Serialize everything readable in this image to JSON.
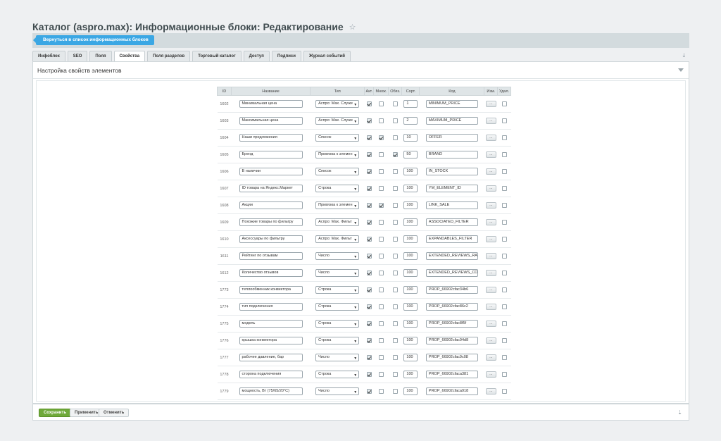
{
  "header": {
    "title": "Каталог (aspro.max): Информационные блоки: Редактирование",
    "star_icon": "star-icon"
  },
  "back_button": "Вернуться в список информационных блоков",
  "tabs": [
    {
      "label": "Инфоблок"
    },
    {
      "label": "SEO"
    },
    {
      "label": "Поля"
    },
    {
      "label": "Свойства",
      "active": true
    },
    {
      "label": "Поля разделов"
    },
    {
      "label": "Торговый каталог"
    },
    {
      "label": "Доступ"
    },
    {
      "label": "Подписи"
    },
    {
      "label": "Журнал событий"
    }
  ],
  "section": {
    "title": "Настройка свойств элементов"
  },
  "table": {
    "headers": [
      "ID",
      "Название",
      "Тип",
      "Акт.",
      "Множ.",
      "Обяз.",
      "Сорт.",
      "Код",
      "Изм.",
      "Удал."
    ],
    "edit_label": "...",
    "rows": [
      {
        "id": "1602",
        "name": "Минимальная цена",
        "type": "Аспро: Мах. Служе",
        "active": true,
        "multiple": false,
        "required": false,
        "sort": "1",
        "code": "MINIMUM_PRICE"
      },
      {
        "id": "1603",
        "name": "Максимальная цена",
        "type": "Аспро: Мах. Служе",
        "active": true,
        "multiple": false,
        "required": false,
        "sort": "2",
        "code": "MAXIMUM_PRICE"
      },
      {
        "id": "1604",
        "name": "Наши предложения",
        "type": "Список",
        "active": true,
        "multiple": true,
        "required": false,
        "sort": "10",
        "code": "OFFER"
      },
      {
        "id": "1605",
        "name": "Бренд",
        "type": "Привязка к элемен",
        "active": true,
        "multiple": false,
        "required": true,
        "sort": "50",
        "code": "BRAND"
      },
      {
        "id": "1606",
        "name": "В наличии",
        "type": "Список",
        "active": true,
        "multiple": false,
        "required": false,
        "sort": "100",
        "code": "IN_STOCK"
      },
      {
        "id": "1607",
        "name": "ID товара на Яндекс.Маркет",
        "type": "Строка",
        "active": true,
        "multiple": false,
        "required": false,
        "sort": "100",
        "code": "YM_ELEMENT_ID"
      },
      {
        "id": "1608",
        "name": "Акции",
        "type": "Привязка к элемен",
        "active": true,
        "multiple": true,
        "required": false,
        "sort": "100",
        "code": "LINK_SALE"
      },
      {
        "id": "1609",
        "name": "Похожие товары по фильтру",
        "type": "Аспро: Мах. Фильт",
        "active": true,
        "multiple": false,
        "required": false,
        "sort": "100",
        "code": "ASSOCIATED_FILTER"
      },
      {
        "id": "1610",
        "name": "Аксессуары по фильтру",
        "type": "Аспро: Мах. Фильт",
        "active": true,
        "multiple": false,
        "required": false,
        "sort": "100",
        "code": "EXPANDABLES_FILTER"
      },
      {
        "id": "1611",
        "name": "Рейтинг по отзывам",
        "type": "Число",
        "active": true,
        "multiple": false,
        "required": false,
        "sort": "100",
        "code": "EXTENDED_REVIEWS_RAI"
      },
      {
        "id": "1612",
        "name": "Количество отзывов",
        "type": "Число",
        "active": true,
        "multiple": false,
        "required": false,
        "sort": "100",
        "code": "EXTENDED_REVIEWS_COI"
      },
      {
        "id": "1773",
        "name": "теплообменник конвектора",
        "type": "Строка",
        "active": true,
        "multiple": false,
        "required": false,
        "sort": "100",
        "code": "PROP_66902cfac34b6"
      },
      {
        "id": "1774",
        "name": "тип подключения",
        "type": "Строка",
        "active": true,
        "multiple": false,
        "required": false,
        "sort": "100",
        "code": "PROP_66902cfac86c2"
      },
      {
        "id": "1775",
        "name": "модель",
        "type": "Строка",
        "active": true,
        "multiple": false,
        "required": false,
        "sort": "100",
        "code": "PROP_66902cfac8f5f"
      },
      {
        "id": "1776",
        "name": "крышка конвектора",
        "type": "Строка",
        "active": true,
        "multiple": false,
        "required": false,
        "sort": "100",
        "code": "PROP_66902cfac94d8"
      },
      {
        "id": "1777",
        "name": "рабочее давление, бар",
        "type": "Число",
        "active": true,
        "multiple": false,
        "required": false,
        "sort": "100",
        "code": "PROP_66902cfac9c08"
      },
      {
        "id": "1778",
        "name": "сторона подключения",
        "type": "Строка",
        "active": true,
        "multiple": false,
        "required": false,
        "sort": "100",
        "code": "PROP_66902cfaca381"
      },
      {
        "id": "1779",
        "name": "мощность, Вт (75/65/20°C)",
        "type": "Число",
        "active": true,
        "multiple": false,
        "required": false,
        "sort": "100",
        "code": "PROP_66902cfaca918"
      }
    ]
  },
  "footer": {
    "save": "Сохранить",
    "apply": "Применить",
    "cancel": "Отменить"
  }
}
